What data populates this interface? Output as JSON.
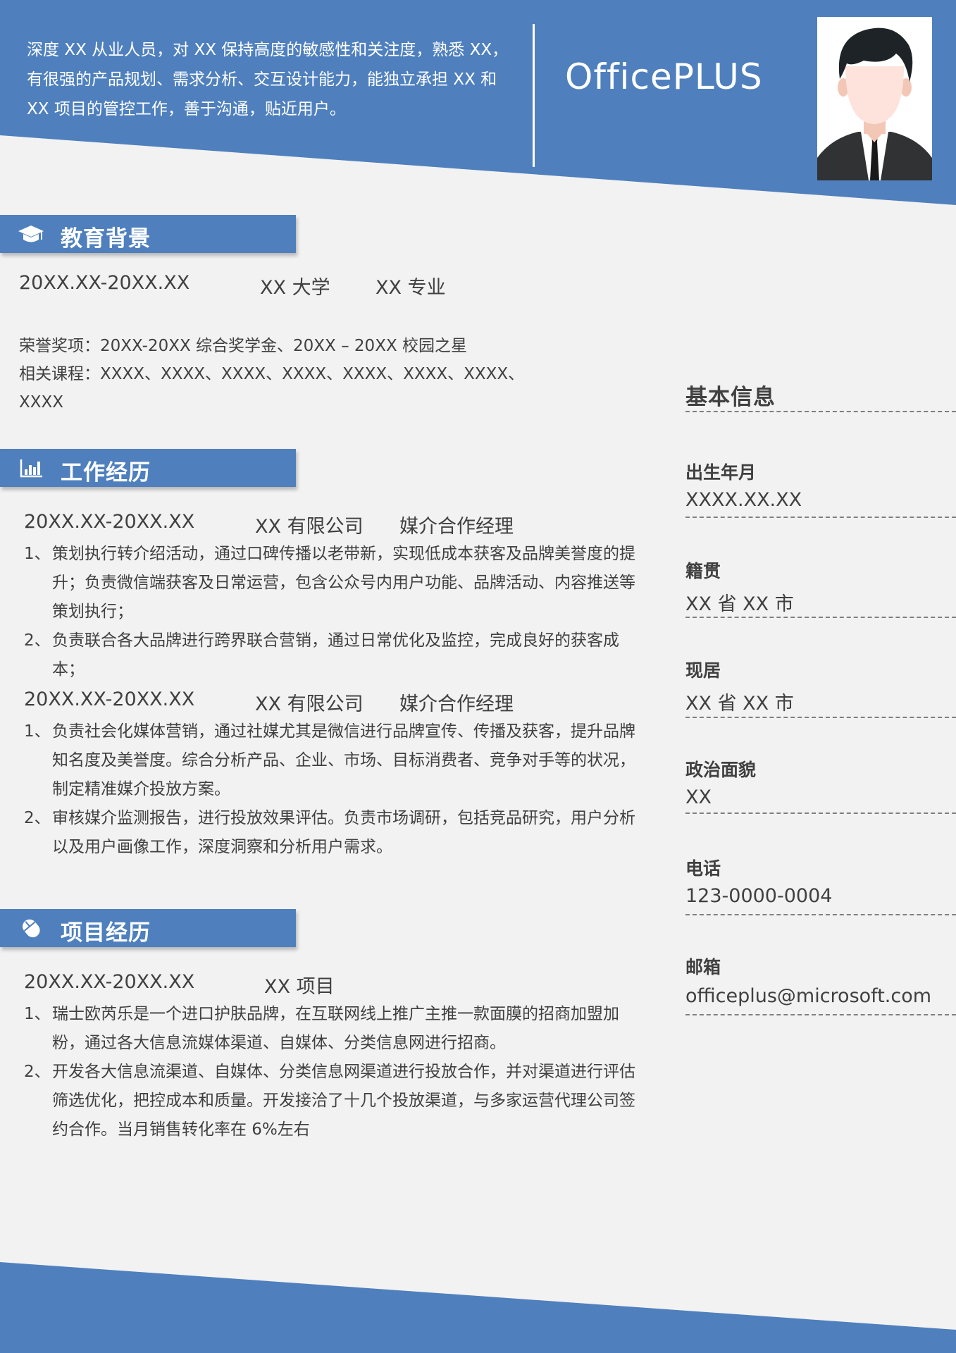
{
  "header": {
    "summary": "深度 XX 从业人员，对 XX 保持高度的敏感性和关注度，熟悉 XX，有很强的产品规划、需求分析、交互设计能力，能独立承担 XX 和 XX 项目的管控工作，善于沟通，贴近用户。",
    "brand": "OfficePLUS",
    "accent_color": "#4f80bd"
  },
  "education": {
    "title": "教育背景",
    "icon": "graduation-cap-icon",
    "period": "20XX.XX-20XX.XX",
    "school": "XX 大学",
    "major": "XX 专业",
    "honors": "荣誉奖项：20XX-20XX  综合奖学金、20XX  –  20XX 校园之星",
    "courses": "相关课程：XXXX、XXXX、XXXX、XXXX、XXXX、XXXX、XXXX、XXXX"
  },
  "work": {
    "title": "工作经历",
    "icon": "bar-chart-icon",
    "jobs": [
      {
        "period": "20XX.XX-20XX.XX",
        "company": "XX 有限公司",
        "role": "媒介合作经理",
        "items": [
          {
            "num": "1、",
            "text": "策划执行转介绍活动，通过口碑传播以老带新，实现低成本获客及品牌美誉度的提升；负责微信端获客及日常运营，包含公众号内用户功能、品牌活动、内容推送等策划执行；"
          },
          {
            "num": "2、",
            "text": "负责联合各大品牌进行跨界联合营销，通过日常优化及监控，完成良好的获客成本；"
          }
        ]
      },
      {
        "period": "20XX.XX-20XX.XX",
        "company": "XX 有限公司",
        "role": "媒介合作经理",
        "items": [
          {
            "num": "1、",
            "text": "负责社会化媒体营销，通过社媒尤其是微信进行品牌宣传、传播及获客，提升品牌知名度及美誉度。综合分析产品、企业、市场、目标消费者、竞争对手等的状况，制定精准媒介投放方案。"
          },
          {
            "num": "2、",
            "text": "审核媒介监测报告，进行投放效果评估。负责市场调研，包括竞品研究，用户分析以及用户画像工作，深度洞察和分析用户需求。"
          }
        ]
      }
    ]
  },
  "project": {
    "title": "项目经历",
    "icon": "mouse-icon",
    "period": "20XX.XX-20XX.XX",
    "name": "XX 项目",
    "items": [
      {
        "num": "1、",
        "text": "瑞士欧芮乐是一个进口护肤品牌，在互联网线上推广主推一款面膜的招商加盟加粉，通过各大信息流媒体渠道、自媒体、分类信息网进行招商。"
      },
      {
        "num": "2、",
        "text": "开发各大信息流渠道、自媒体、分类信息网渠道进行投放合作，并对渠道进行评估筛选优化，把控成本和质量。开发接洽了十几个投放渠道，与多家运营代理公司签约合作。当月销售转化率在 6%左右"
      }
    ]
  },
  "basic_info": {
    "title": "基本信息",
    "fields": [
      {
        "label": "出生年月",
        "value": "XXXX.XX.XX"
      },
      {
        "label": "籍贯",
        "value": "XX 省 XX 市"
      },
      {
        "label": "现居",
        "value": "XX 省 XX 市"
      },
      {
        "label": "政治面貌",
        "value": "XX"
      },
      {
        "label": "电话",
        "value": "123-0000-0004"
      },
      {
        "label": "邮箱",
        "value": "officeplus@microsoft.com"
      }
    ]
  }
}
